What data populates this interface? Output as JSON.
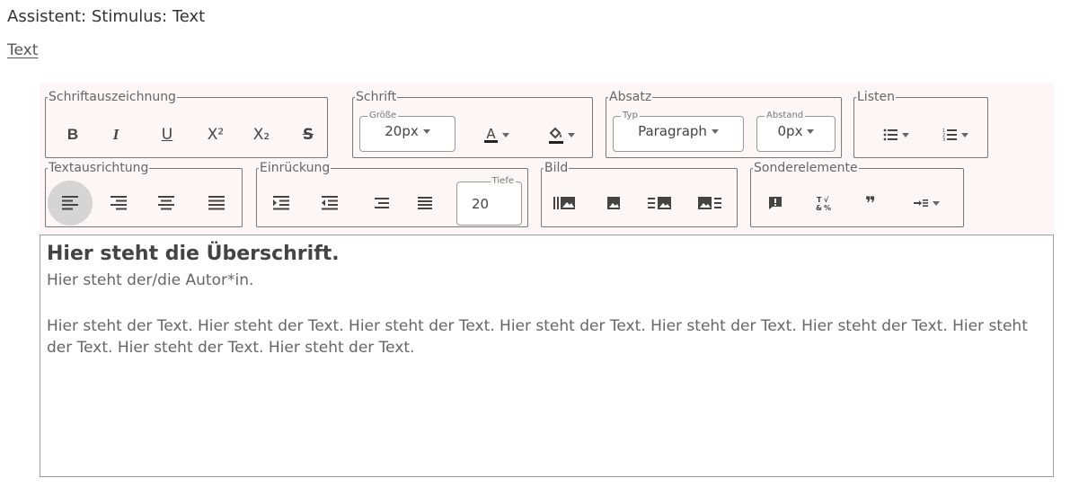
{
  "header": {
    "title": "Assistent: Stimulus: Text",
    "tab": "Text"
  },
  "toolbar": {
    "schriftauszeichnung": {
      "legend": "Schriftauszeichnung",
      "bold": "B",
      "italic": "I",
      "underline": "U",
      "superscript": "X²",
      "subscript": "X₂",
      "strike": "S"
    },
    "schrift": {
      "legend": "Schrift",
      "size_label": "Größe",
      "size_value": "20px",
      "text_color_glyph": "A"
    },
    "absatz": {
      "legend": "Absatz",
      "type_label": "Typ",
      "type_value": "Paragraph",
      "spacing_label": "Abstand",
      "spacing_value": "0px"
    },
    "listen": {
      "legend": "Listen"
    },
    "textausrichtung": {
      "legend": "Textausrichtung",
      "active": "left"
    },
    "einrueckung": {
      "legend": "Einrückung",
      "depth_label": "Tiefe",
      "depth_value": "20"
    },
    "bild": {
      "legend": "Bild"
    },
    "sonderelemente": {
      "legend": "Sonderelemente",
      "quote_glyph": "❞"
    }
  },
  "editor": {
    "heading": "Hier steht die Überschrift.",
    "author": "Hier steht der/die Autor*in.",
    "body": "Hier steht der Text. Hier steht der Text. Hier steht der Text. Hier steht der Text. Hier steht der Text. Hier steht der Text. Hier steht der Text. Hier steht der Text. Hier steht der Text."
  }
}
